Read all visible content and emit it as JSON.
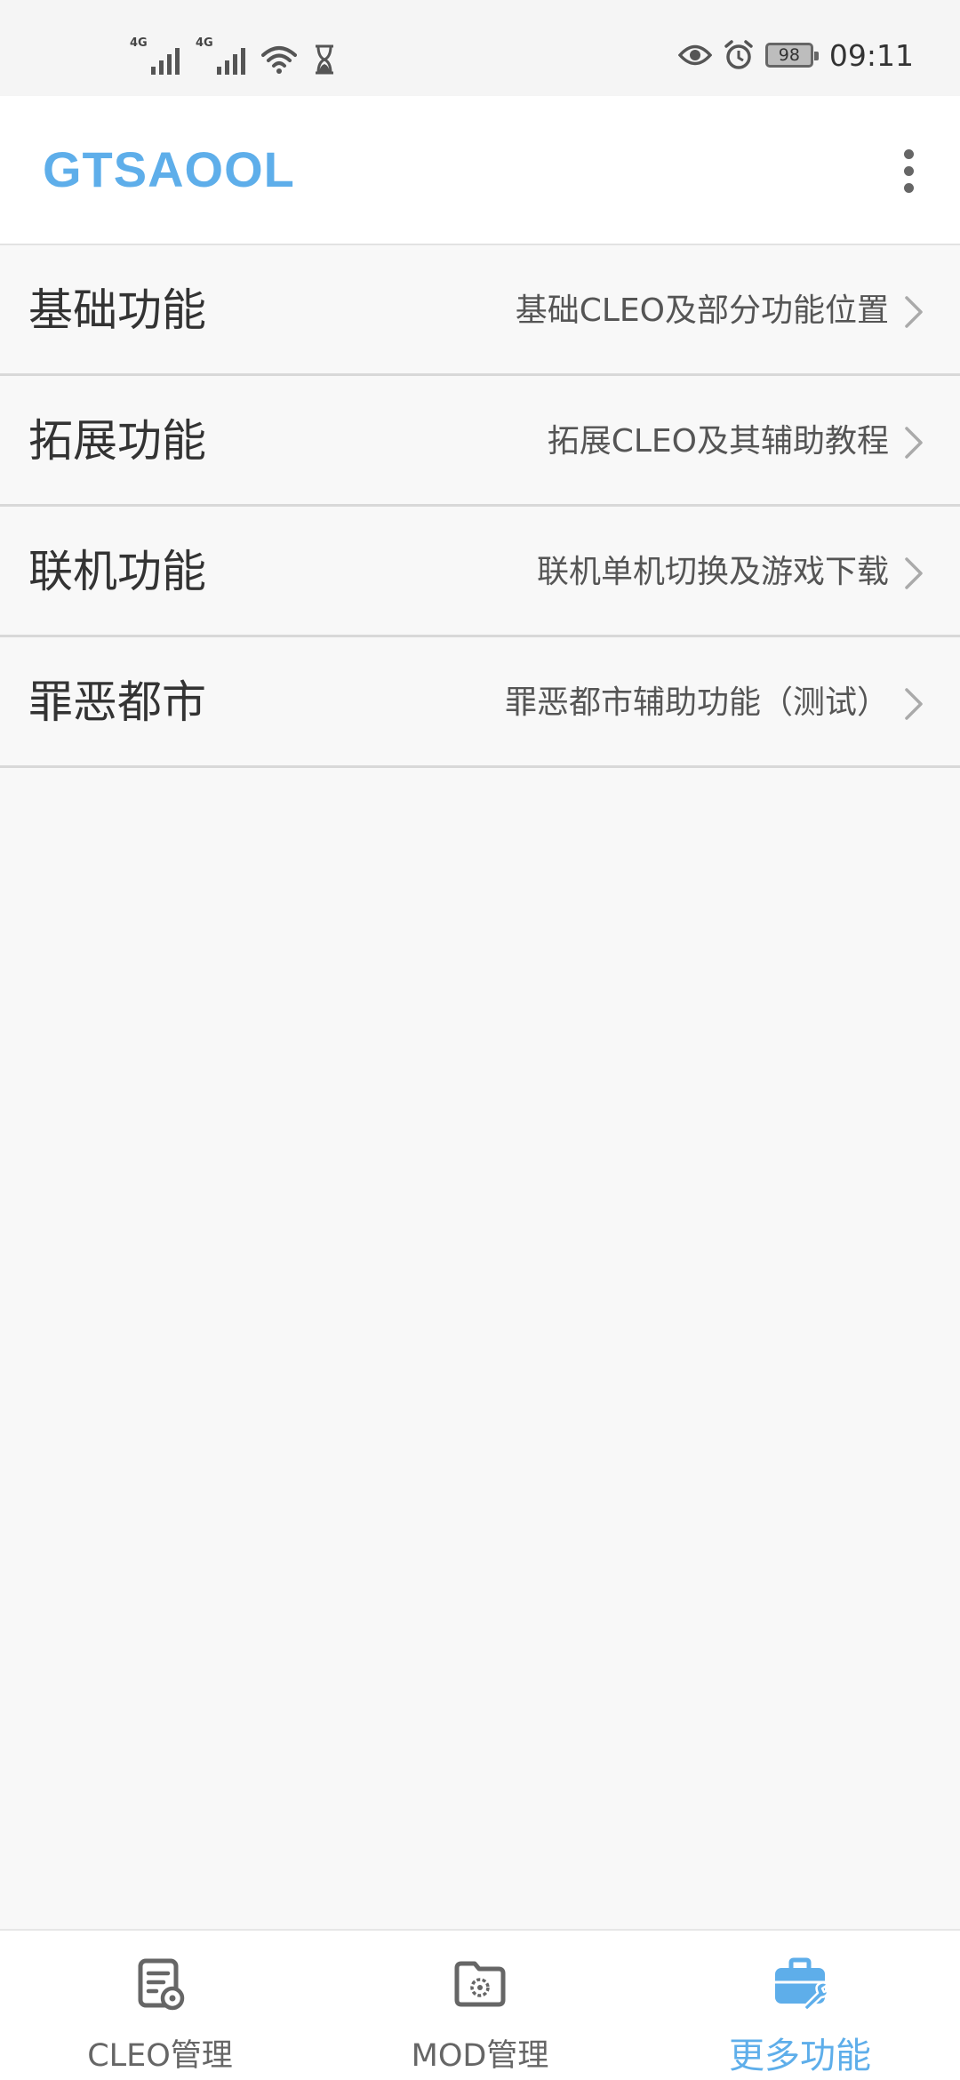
{
  "status_bar": {
    "network_1": "4G",
    "network_2": "4G",
    "battery": "98",
    "time": "09:11",
    "icons": [
      "signal-icon",
      "signal-icon",
      "wifi-icon",
      "hourglass-icon",
      "eye-icon",
      "alarm-icon",
      "battery-icon"
    ]
  },
  "app_bar": {
    "title": "GTSAOOL",
    "more_icon": "more-vert-icon"
  },
  "menu": [
    {
      "title": "基础功能",
      "desc": "基础CLEO及部分功能位置"
    },
    {
      "title": "拓展功能",
      "desc": "拓展CLEO及其辅助教程"
    },
    {
      "title": "联机功能",
      "desc": "联机单机切换及游戏下载"
    },
    {
      "title": "罪恶都市",
      "desc": "罪恶都市辅助功能（测试）"
    }
  ],
  "bottom_nav": [
    {
      "label": "CLEO管理",
      "icon": "document-gear-icon",
      "active": false
    },
    {
      "label": "MOD管理",
      "icon": "folder-gear-icon",
      "active": false
    },
    {
      "label": "更多功能",
      "icon": "toolbox-icon",
      "active": true
    }
  ],
  "colors": {
    "accent": "#5eaeea",
    "background": "#f8f8f8",
    "divider": "#d8d8d8"
  }
}
